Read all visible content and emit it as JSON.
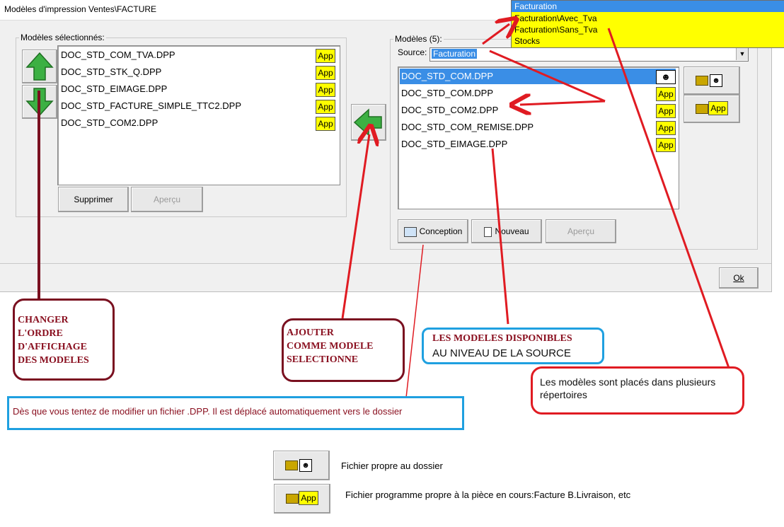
{
  "window": {
    "title": "Modèles d'impression  Ventes\\FACTURE",
    "close_glyph": "✕"
  },
  "selected": {
    "group_label": "Modèles sélectionnés:",
    "items": [
      "DOC_STD_COM_TVA.DPP",
      "DOC_STD_STK_Q.DPP",
      "DOC_STD_EIMAGE.DPP",
      "DOC_STD_FACTURE_SIMPLE_TTC2.DPP",
      "DOC_STD_COM2.DPP"
    ],
    "badge": "App",
    "delete_button": "Supprimer",
    "preview_button": "Aperçu"
  },
  "models": {
    "group_label": "Modèles (5):",
    "source_label": "Source:",
    "source_value": "Facturation",
    "dropdown_options": [
      "Facturation",
      "Facturation\\Avec_Tva",
      "Facturation\\Sans_Tva",
      "Stocks"
    ],
    "items": [
      "DOC_STD_COM.DPP",
      "DOC_STD_COM.DPP",
      "DOC_STD_COM2.DPP",
      "DOC_STD_COM_REMISE.DPP",
      "DOC_STD_EIMAGE.DPP"
    ],
    "badge": "App",
    "design_button": "Conception",
    "new_button": "Nouveau",
    "preview_button": "Aperçu"
  },
  "ok_button": "Ok",
  "annotations": {
    "order": [
      "CHANGER",
      "L'ORDRE",
      "D'AFFICHAGE",
      "DES MODELES"
    ],
    "add": [
      "AJOUTER",
      "COMME MODELE",
      "SELECTIONNE"
    ],
    "available_line1": "LES MODELES DISPONIBLES",
    "available_line2": "AU NIVEAU DE LA SOURCE",
    "folders_note": "Les modèles sont placés dans plusieurs répertoires",
    "dpp_note": "Dès que vous tentez de modifier un fichier .DPP. Il est déplacé automatiquement vers le dossier"
  },
  "legend": {
    "folder_file": "Fichier propre au dossier",
    "program_file": "Fichier programme propre à la pièce en cours:Facture B.Livraison, etc",
    "badge": "App"
  },
  "colors": {
    "selection": "#3a8ee6",
    "badge": "#ffff00",
    "annotation_red": "#e01b22",
    "annotation_maroon": "#7a1020",
    "annotation_blue": "#1fa0e0"
  }
}
